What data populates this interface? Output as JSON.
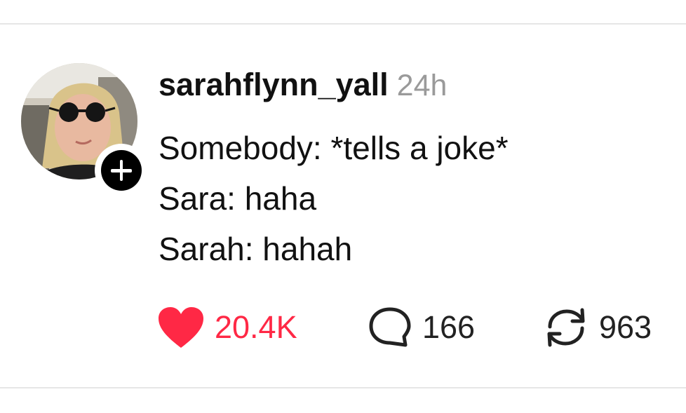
{
  "post": {
    "username": "sarahflynn_yall",
    "time": "24h",
    "lines": [
      "Somebody: *tells a joke*",
      "Sara: haha",
      "Sarah: hahah"
    ],
    "likes": "20.4K",
    "replies": "166",
    "reposts": "963"
  },
  "icons": {
    "follow": "plus-icon",
    "like": "heart-icon",
    "reply": "comment-bubble-icon",
    "repost": "repost-icon"
  },
  "colors": {
    "like": "#ff2845",
    "timestamp": "#9a9a9a",
    "divider": "#e6e6e6",
    "text": "#111111"
  }
}
